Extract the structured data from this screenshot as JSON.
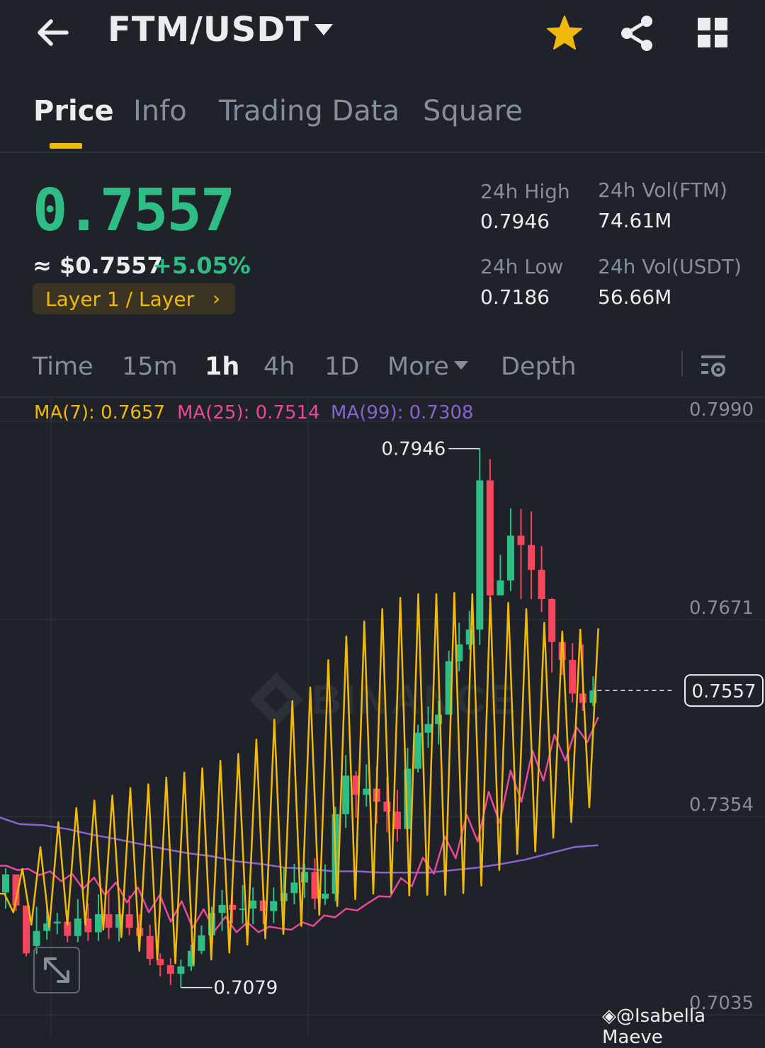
{
  "header": {
    "pair": "FTM/USDT",
    "icons": [
      "back-arrow-icon",
      "caret-down-icon",
      "star-icon",
      "share-icon",
      "grid-icon"
    ]
  },
  "tabs": [
    {
      "label": "Price",
      "active": true
    },
    {
      "label": "Info",
      "active": false
    },
    {
      "label": "Trading Data",
      "active": false
    },
    {
      "label": "Square",
      "active": false
    }
  ],
  "summary": {
    "price": "0.7557",
    "approx": "≈ $0.7557",
    "change": "+5.05%",
    "tag": "Layer 1 / Layer",
    "tag_chevron": "›",
    "high_label": "24h High",
    "high_value": "0.7946",
    "low_label": "24h Low",
    "low_value": "0.7186",
    "vol_ftm_label": "24h Vol(FTM)",
    "vol_ftm_value": "74.61M",
    "vol_usdt_label": "24h Vol(USDT)",
    "vol_usdt_value": "56.66M"
  },
  "timeframes": {
    "items": [
      "Time",
      "15m",
      "1h",
      "4h",
      "1D",
      "More",
      "Depth"
    ],
    "active": "1h"
  },
  "indicators": {
    "ma7": "MA(7): 0.7657",
    "ma25": "MA(25): 0.7514",
    "ma99": "MA(99): 0.7308"
  },
  "colors": {
    "up": "#2ebd85",
    "down": "#f6465d",
    "ma7": "#f0b90b",
    "ma25": "#e9489b",
    "ma99": "#8a63d2",
    "accent": "#f0b90b"
  },
  "watermark_user": "@Isabella Maeve",
  "chart_data": {
    "type": "candlestick",
    "y_ticks": [
      0.799,
      0.7671,
      0.7354,
      0.7035
    ],
    "y_tick_labels": [
      "0.7990",
      "0.7671",
      "0.7354",
      "0.7035"
    ],
    "ylim": [
      0.7005,
      0.801
    ],
    "current_price": 0.7557,
    "current_price_label": "0.7557",
    "high_marker": {
      "value": 0.7946,
      "label": "0.7946"
    },
    "low_marker": {
      "value": 0.7079,
      "label": "0.7079"
    },
    "watermark": "BINANCE",
    "candles": [
      [
        0.7232,
        0.7261,
        0.7206,
        0.7271
      ],
      [
        0.7261,
        0.7211,
        0.7202,
        0.7261
      ],
      [
        0.7211,
        0.7134,
        0.7129,
        0.7211
      ],
      [
        0.7146,
        0.717,
        0.7133,
        0.7209
      ],
      [
        0.717,
        0.7182,
        0.7156,
        0.7217
      ],
      [
        0.7182,
        0.7185,
        0.7165,
        0.7199
      ],
      [
        0.7185,
        0.7162,
        0.7152,
        0.7203
      ],
      [
        0.7162,
        0.719,
        0.7152,
        0.7221
      ],
      [
        0.719,
        0.7168,
        0.7154,
        0.7214
      ],
      [
        0.7168,
        0.7197,
        0.7154,
        0.7229
      ],
      [
        0.7197,
        0.7175,
        0.7157,
        0.7236
      ],
      [
        0.7175,
        0.7197,
        0.7153,
        0.7225
      ],
      [
        0.7197,
        0.7175,
        0.7163,
        0.7227
      ],
      [
        0.7175,
        0.7162,
        0.7143,
        0.7197
      ],
      [
        0.7162,
        0.7125,
        0.7115,
        0.718
      ],
      [
        0.7125,
        0.7115,
        0.7097,
        0.7134
      ],
      [
        0.7115,
        0.7101,
        0.7083,
        0.7126
      ],
      [
        0.7101,
        0.7113,
        0.7079,
        0.7124
      ],
      [
        0.7113,
        0.7138,
        0.7106,
        0.7148
      ],
      [
        0.7138,
        0.7163,
        0.7133,
        0.7179
      ],
      [
        0.7163,
        0.7199,
        0.7136,
        0.7209
      ],
      [
        0.7199,
        0.7212,
        0.717,
        0.7236
      ],
      [
        0.7212,
        0.7204,
        0.7182,
        0.7234
      ],
      [
        0.7204,
        0.7206,
        0.7182,
        0.7244
      ],
      [
        0.7206,
        0.7219,
        0.7181,
        0.724
      ],
      [
        0.7219,
        0.7202,
        0.7181,
        0.7238
      ],
      [
        0.7202,
        0.7218,
        0.7183,
        0.724
      ],
      [
        0.7218,
        0.7231,
        0.7208,
        0.7273
      ],
      [
        0.7231,
        0.7248,
        0.7213,
        0.7278
      ],
      [
        0.7248,
        0.7265,
        0.7223,
        0.7278
      ],
      [
        0.7265,
        0.7222,
        0.7205,
        0.7287
      ],
      [
        0.7222,
        0.723,
        0.7212,
        0.7277
      ],
      [
        0.723,
        0.7358,
        0.7218,
        0.737
      ],
      [
        0.7358,
        0.742,
        0.7336,
        0.7453
      ],
      [
        0.742,
        0.7389,
        0.7352,
        0.7427
      ],
      [
        0.7389,
        0.7399,
        0.737,
        0.7438
      ],
      [
        0.7399,
        0.7378,
        0.7343,
        0.7434
      ],
      [
        0.7378,
        0.7362,
        0.7329,
        0.7418
      ],
      [
        0.7362,
        0.7334,
        0.7314,
        0.7397
      ],
      [
        0.7334,
        0.7431,
        0.733,
        0.7465
      ],
      [
        0.7431,
        0.7489,
        0.7425,
        0.7502
      ],
      [
        0.7489,
        0.7503,
        0.7465,
        0.7531
      ],
      [
        0.7503,
        0.7518,
        0.747,
        0.754
      ],
      [
        0.7518,
        0.7604,
        0.7518,
        0.7621
      ],
      [
        0.7604,
        0.7631,
        0.7588,
        0.7666
      ],
      [
        0.7631,
        0.7655,
        0.7623,
        0.7685
      ],
      [
        0.7655,
        0.7895,
        0.763,
        0.7946
      ],
      [
        0.7895,
        0.771,
        0.7686,
        0.7929
      ],
      [
        0.771,
        0.7734,
        0.771,
        0.7775
      ],
      [
        0.7734,
        0.7806,
        0.7717,
        0.785
      ],
      [
        0.7806,
        0.7791,
        0.7704,
        0.7849
      ],
      [
        0.7791,
        0.7751,
        0.7704,
        0.7845
      ],
      [
        0.7751,
        0.7704,
        0.7683,
        0.7789
      ],
      [
        0.7704,
        0.7635,
        0.7586,
        0.7706
      ],
      [
        0.7635,
        0.7606,
        0.7582,
        0.7651
      ],
      [
        0.7606,
        0.7552,
        0.7538,
        0.7633
      ],
      [
        0.7552,
        0.7537,
        0.7524,
        0.7631
      ],
      [
        0.7537,
        0.7557,
        0.7532,
        0.758
      ]
    ],
    "ma7": [
      [
        0.723,
        0.723
      ],
      [
        0.72,
        0.727
      ],
      [
        0.718,
        0.7305
      ],
      [
        0.7176,
        0.7345
      ],
      [
        0.718,
        0.7368
      ],
      [
        0.718,
        0.738
      ],
      [
        0.7172,
        0.7388
      ],
      [
        0.716,
        0.74
      ],
      [
        0.7138,
        0.7406
      ],
      [
        0.7124,
        0.7417
      ],
      [
        0.7118,
        0.7425
      ],
      [
        0.7117,
        0.7432
      ],
      [
        0.7124,
        0.7444
      ],
      [
        0.7135,
        0.7455
      ],
      [
        0.7148,
        0.7478
      ],
      [
        0.7158,
        0.751
      ],
      [
        0.7165,
        0.754
      ],
      [
        0.7178,
        0.7562
      ],
      [
        0.7196,
        0.7606
      ],
      [
        0.721,
        0.7644
      ],
      [
        0.7221,
        0.7668
      ],
      [
        0.723,
        0.7688
      ],
      [
        0.7231,
        0.7706
      ],
      [
        0.7227,
        0.7712
      ],
      [
        0.7228,
        0.7712
      ],
      [
        0.7228,
        0.7714
      ],
      [
        0.7231,
        0.7712
      ],
      [
        0.7243,
        0.7706
      ],
      [
        0.7268,
        0.7698
      ],
      [
        0.7294,
        0.7688
      ],
      [
        0.7298,
        0.7666
      ],
      [
        0.732,
        0.7652
      ],
      [
        0.7345,
        0.7655
      ],
      [
        0.7369,
        0.7657
      ]
    ],
    "ma25": [
      [
        0.7275,
        0.7275
      ],
      [
        0.7268,
        0.727
      ],
      [
        0.726,
        0.7266
      ],
      [
        0.725,
        0.7262
      ],
      [
        0.7238,
        0.7256
      ],
      [
        0.7228,
        0.7248
      ],
      [
        0.7216,
        0.724
      ],
      [
        0.72,
        0.7228
      ],
      [
        0.7185,
        0.7218
      ],
      [
        0.7175,
        0.7205
      ],
      [
        0.717,
        0.7193
      ],
      [
        0.7168,
        0.7184
      ],
      [
        0.7168,
        0.7177
      ],
      [
        0.7174,
        0.7172
      ],
      [
        0.7184,
        0.7178
      ],
      [
        0.7195,
        0.7192
      ],
      [
        0.7206,
        0.7203
      ],
      [
        0.7215,
        0.7226
      ],
      [
        0.7225,
        0.7255
      ],
      [
        0.7242,
        0.7288
      ],
      [
        0.7262,
        0.7322
      ],
      [
        0.7287,
        0.7357
      ],
      [
        0.7314,
        0.7394
      ],
      [
        0.7344,
        0.7428
      ],
      [
        0.7378,
        0.746
      ],
      [
        0.7412,
        0.7486
      ],
      [
        0.7444,
        0.7498
      ],
      [
        0.7474,
        0.7514
      ]
    ],
    "ma99": [
      [
        0.7355,
        0.7342
      ],
      [
        0.734,
        0.7334
      ],
      [
        0.7325,
        0.7318
      ],
      [
        0.731,
        0.7302
      ],
      [
        0.7295,
        0.729
      ],
      [
        0.7282,
        0.7278
      ],
      [
        0.7272,
        0.727
      ],
      [
        0.7266,
        0.7266
      ],
      [
        0.7264,
        0.7264
      ],
      [
        0.7264,
        0.7268
      ],
      [
        0.7272,
        0.7278
      ],
      [
        0.7285,
        0.7295
      ],
      [
        0.7305,
        0.7308
      ]
    ]
  }
}
